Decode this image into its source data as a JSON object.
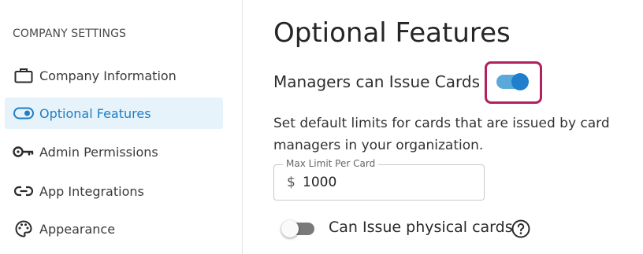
{
  "sidebar": {
    "heading": "COMPANY SETTINGS",
    "items": [
      {
        "label": "Company Information",
        "icon": "briefcase-icon",
        "active": false
      },
      {
        "label": "Optional Features",
        "icon": "toggle-icon",
        "active": true
      },
      {
        "label": "Admin Permissions",
        "icon": "key-icon",
        "active": false
      },
      {
        "label": "App Integrations",
        "icon": "link-icon",
        "active": false
      },
      {
        "label": "Appearance",
        "icon": "palette-icon",
        "active": false
      }
    ]
  },
  "main": {
    "title": "Optional Features",
    "managers_issue_cards": {
      "label": "Managers can Issue Cards",
      "enabled": true
    },
    "description": "Set default limits for cards that are issued by card managers in your organization.",
    "max_limit": {
      "legend": "Max Limit Per Card",
      "prefix": "$",
      "value": "1000"
    },
    "physical_cards": {
      "label": "Can Issue physical cards",
      "enabled": false
    }
  },
  "colors": {
    "accent": "#1f7fcd",
    "active_nav_bg": "#e6f3fb",
    "highlight_border": "#b0215e"
  }
}
